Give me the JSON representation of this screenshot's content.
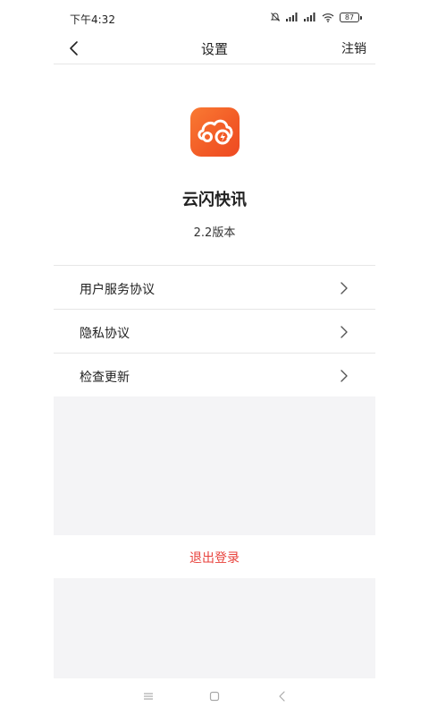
{
  "status_bar": {
    "time": "下午4:32",
    "battery": "87",
    "icons": [
      "bell-off-icon",
      "signal-icon",
      "signal-icon",
      "wifi-icon",
      "battery-icon"
    ]
  },
  "nav": {
    "title": "设置",
    "action": "注销",
    "back_icon": "chevron-left-icon"
  },
  "app": {
    "name": "云闪快讯",
    "version": "2.2版本",
    "logo_icon": "cloud-lightning-icon",
    "logo_color": "#f25a26"
  },
  "menu": {
    "items": [
      {
        "label": "用户服务协议"
      },
      {
        "label": "隐私协议"
      },
      {
        "label": "检查更新"
      }
    ]
  },
  "logout": {
    "label": "退出登录",
    "color": "#e8423c"
  },
  "system_nav": {
    "icons": [
      "menu-icon",
      "home-square-icon",
      "back-triangle-icon"
    ]
  }
}
